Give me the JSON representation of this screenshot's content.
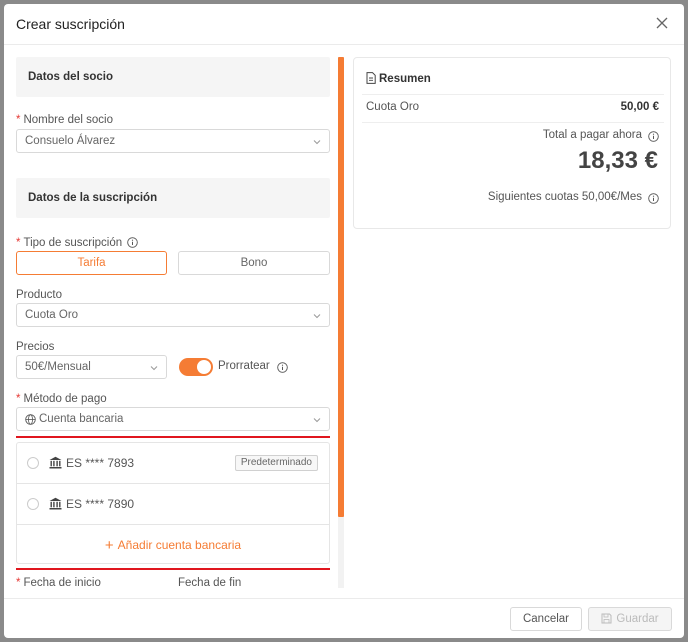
{
  "modal": {
    "title": "Crear suscripción"
  },
  "socio": {
    "section_title": "Datos del socio",
    "label": "Nombre del socio",
    "value": "Consuelo Álvarez"
  },
  "suscripcion": {
    "section_title": "Datos de la suscripción",
    "tipo_label": "Tipo de suscripción",
    "tipo_options": [
      "Tarifa",
      "Bono"
    ],
    "tipo_selected": "Tarifa",
    "producto_label": "Producto",
    "producto_value": "Cuota Oro",
    "precios_label": "Precios",
    "precios_value": "50€/Mensual",
    "prorratear_label": "Prorratear",
    "prorratear_on": true,
    "metodo_label": "Método de pago",
    "metodo_value": "Cuenta bancaria",
    "accounts": [
      {
        "number": "ES **** 7893",
        "badge": "Predeterminado"
      },
      {
        "number": "ES **** 7890",
        "badge": ""
      }
    ],
    "add_account": "Añadir cuenta bancaria",
    "fecha_inicio_label": "Fecha de inicio",
    "fecha_fin_label": "Fecha de fin"
  },
  "resumen": {
    "title": "Resumen",
    "item_label": "Cuota Oro",
    "item_value": "50,00 €",
    "total_label": "Total a pagar ahora",
    "total_amount": "18,33 €",
    "next_label": "Siguientes cuotas 50,00€/Mes"
  },
  "footer": {
    "cancel": "Cancelar",
    "save": "Guardar"
  },
  "colors": {
    "accent": "#f57c34",
    "highlight": "#e0161e",
    "required": "#e53935"
  }
}
